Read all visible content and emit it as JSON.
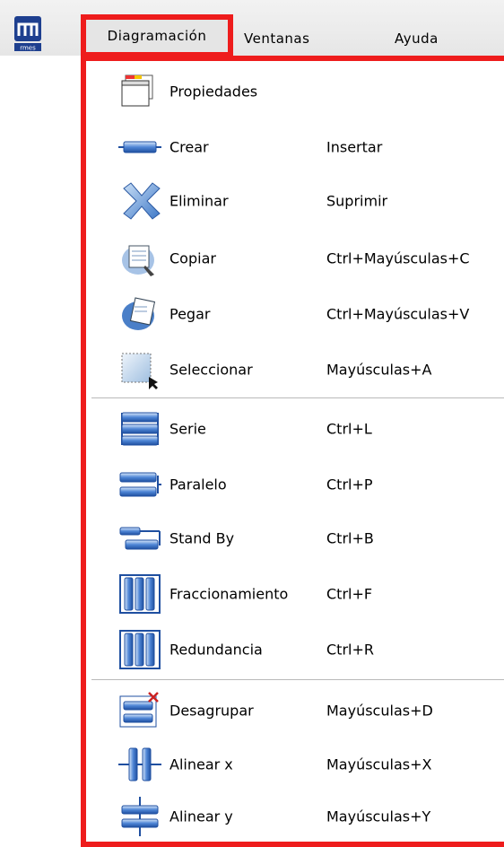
{
  "app": {
    "logo_text": "rmes"
  },
  "menubar": {
    "items": [
      {
        "label": "Diagramación"
      },
      {
        "label": "Ventanas"
      },
      {
        "label": "Ayuda"
      }
    ]
  },
  "accent_color": "#ee1c1c",
  "dropdown": {
    "items": [
      {
        "label": "Propiedades",
        "shortcut": "",
        "icon": "properties-icon"
      },
      {
        "label": "Crear",
        "shortcut": "Insertar",
        "icon": "create-block-icon"
      },
      {
        "label": "Eliminar",
        "shortcut": "Suprimir",
        "icon": "delete-x-icon"
      },
      {
        "label": "Copiar",
        "shortcut": "Ctrl+Mayúsculas+C",
        "icon": "copy-icon"
      },
      {
        "label": "Pegar",
        "shortcut": "Ctrl+Mayúsculas+V",
        "icon": "paste-icon"
      },
      {
        "label": "Seleccionar",
        "shortcut": "Mayúsculas+A",
        "icon": "select-icon"
      },
      {
        "label": "Serie",
        "shortcut": "Ctrl+L",
        "icon": "series-icon"
      },
      {
        "label": "Paralelo",
        "shortcut": "Ctrl+P",
        "icon": "parallel-icon"
      },
      {
        "label": "Stand By",
        "shortcut": "Ctrl+B",
        "icon": "standby-icon"
      },
      {
        "label": "Fraccionamiento",
        "shortcut": "Ctrl+F",
        "icon": "fraction-icon"
      },
      {
        "label": "Redundancia",
        "shortcut": "Ctrl+R",
        "icon": "redundancy-icon"
      },
      {
        "label": "Desagrupar",
        "shortcut": "Mayúsculas+D",
        "icon": "ungroup-icon"
      },
      {
        "label": "Alinear x",
        "shortcut": "Mayúsculas+X",
        "icon": "align-x-icon"
      },
      {
        "label": "Alinear y",
        "shortcut": "Mayúsculas+Y",
        "icon": "align-y-icon"
      }
    ]
  }
}
